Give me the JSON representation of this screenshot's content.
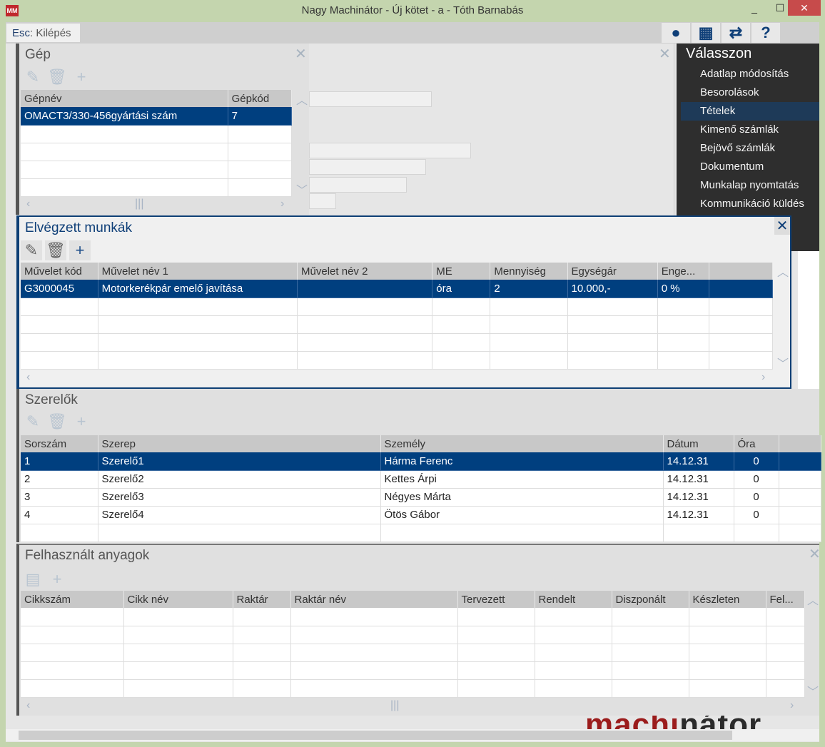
{
  "window": {
    "title": "Nagy Machinátor - Új kötet - a - Tóth Barnabás",
    "app_icon": "MM",
    "minimize": "_",
    "maximize": "☐",
    "close": "✕"
  },
  "toolbar": {
    "esc_key": "Esc",
    "esc_label": "Kilépés",
    "icons": [
      "user-icon",
      "grid-icon",
      "swap-icon",
      "help-icon"
    ]
  },
  "right_menu": {
    "title": "Válasszon",
    "items": [
      "Adatlap módosítás",
      "Besorolások",
      "Tételek",
      "Kimenő számlák",
      "Bejövő számlák",
      "Dokumentum",
      "Munkalap nyomtatás",
      "Kommunikáció küldés"
    ],
    "selected": 2
  },
  "gep": {
    "title": "Gép",
    "columns": [
      "Gépnév",
      "Gépkód"
    ],
    "rows": [
      [
        "OMACT3/330-456gyártási szám",
        "7"
      ],
      [
        "",
        ""
      ],
      [
        "",
        ""
      ],
      [
        "",
        ""
      ],
      [
        "",
        ""
      ]
    ]
  },
  "munkak": {
    "title": "Elvégzett munkák",
    "columns": [
      "Művelet kód",
      "Művelet név 1",
      "Művelet név 2",
      "ME",
      "Mennyiség",
      "Egységár",
      "Enge...",
      ""
    ],
    "rows": [
      [
        "G3000045",
        "Motorkerékpár emelő javítása",
        "",
        "óra",
        "2",
        "10.000,-",
        "0 %",
        ""
      ],
      [
        "",
        "",
        "",
        "",
        "",
        "",
        "",
        ""
      ],
      [
        "",
        "",
        "",
        "",
        "",
        "",
        "",
        ""
      ],
      [
        "",
        "",
        "",
        "",
        "",
        "",
        "",
        ""
      ],
      [
        "",
        "",
        "",
        "",
        "",
        "",
        "",
        ""
      ]
    ]
  },
  "szerelok": {
    "title": "Szerelők",
    "columns": [
      "Sorszám",
      "Szerep",
      "Személy",
      "Dátum",
      "Óra",
      ""
    ],
    "rows": [
      [
        "1",
        "Szerelő1",
        "Hárma Ferenc",
        "14.12.31",
        "0",
        ""
      ],
      [
        "2",
        "Szerelő2",
        "Kettes Árpi",
        "14.12.31",
        "0",
        ""
      ],
      [
        "3",
        "Szerelő3",
        "Négyes Márta",
        "14.12.31",
        "0",
        ""
      ],
      [
        "4",
        "Szerelő4",
        "Ötös Gábor",
        "14.12.31",
        "0",
        ""
      ],
      [
        "",
        "",
        "",
        "",
        "",
        ""
      ]
    ]
  },
  "anyagok": {
    "title": "Felhasznált anyagok",
    "columns": [
      "Cikkszám",
      "Cikk név",
      "Raktár",
      "Raktár név",
      "Tervezett",
      "Rendelt",
      "Diszponált",
      "Készleten",
      "Fel..."
    ],
    "rows": [
      [
        "",
        "",
        "",
        "",
        "",
        "",
        "",
        "",
        ""
      ],
      [
        "",
        "",
        "",
        "",
        "",
        "",
        "",
        "",
        ""
      ],
      [
        "",
        "",
        "",
        "",
        "",
        "",
        "",
        "",
        ""
      ],
      [
        "",
        "",
        "",
        "",
        "",
        "",
        "",
        "",
        ""
      ],
      [
        "",
        "",
        "",
        "",
        "",
        "",
        "",
        "",
        ""
      ]
    ]
  },
  "logo": {
    "text_red": "machi",
    "text_dark": "nátor"
  }
}
